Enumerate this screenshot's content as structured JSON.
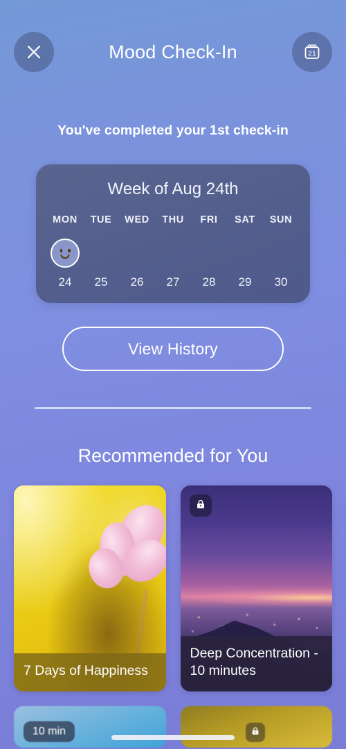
{
  "header": {
    "title": "Mood Check-In",
    "close_icon": "close-icon",
    "calendar_icon": "calendar-icon",
    "calendar_day": "21"
  },
  "subtitle": "You've completed your 1st check-in",
  "week_card": {
    "title": "Week of Aug 24th",
    "days": [
      "MON",
      "TUE",
      "WED",
      "THU",
      "FRI",
      "SAT",
      "SUN"
    ],
    "dates": [
      "24",
      "25",
      "26",
      "27",
      "28",
      "29",
      "30"
    ],
    "mood_entries": [
      {
        "day_index": 0,
        "icon": "smiley-face-icon",
        "mood": "neutral-happy"
      }
    ]
  },
  "history_button": {
    "label": "View History"
  },
  "recommended": {
    "heading": "Recommended for You",
    "cards": [
      {
        "title": "7 Days of Happiness",
        "art": "yellow-lotus-flower",
        "locked": false
      },
      {
        "title": "Deep Concentration - 10 minutes",
        "art": "twilight-mountain-cityscape",
        "locked": true,
        "lock_icon": "lock-icon"
      }
    ],
    "partial_cards": [
      {
        "badge": "10 min",
        "art": "blue-sky",
        "locked": false
      },
      {
        "badge": "",
        "art": "golden-field",
        "locked": true,
        "lock_icon": "lock-icon"
      }
    ]
  },
  "colors": {
    "background_top": "#7399d6",
    "background_bottom": "#7a7dd6",
    "week_card": "#545f8e",
    "accent_white": "#ffffff",
    "caption_gold": "#7c6616",
    "caption_dark": "#2a243e"
  }
}
